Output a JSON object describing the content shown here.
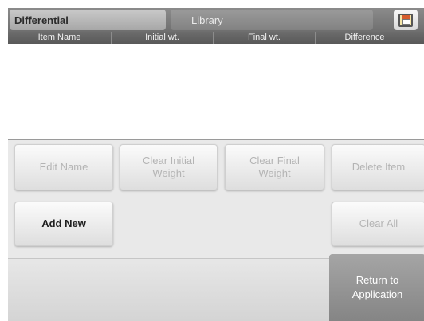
{
  "header": {
    "tab_differential": "Differential",
    "tab_library": "Library",
    "save_icon": "floppy-disk-icon"
  },
  "table": {
    "columns": [
      "Item Name",
      "Initial wt.",
      "Final wt.",
      "Difference"
    ],
    "rows": []
  },
  "buttons": {
    "edit_name": "Edit Name",
    "clear_initial_weight": "Clear Initial\nWeight",
    "clear_final_weight": "Clear Final\nWeight",
    "delete_item": "Delete Item",
    "add_new": "Add New",
    "clear_all": "Clear All",
    "return_to_application": "Return to\nApplication"
  },
  "colors": {
    "header_bg": "#7a7a7a",
    "active_tab": "#b8b8b8",
    "disabled_text": "#b4b4b4",
    "return_button": "#959595"
  }
}
